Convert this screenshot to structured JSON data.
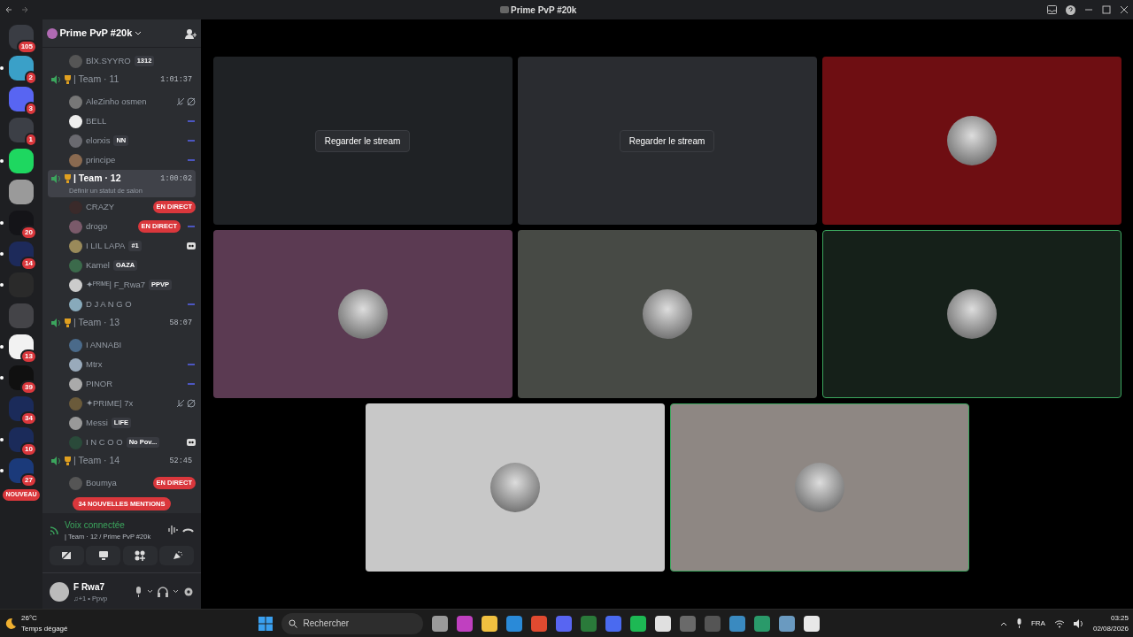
{
  "window": {
    "title": "Prime PvP #20k"
  },
  "servers": [
    {
      "badge": "105",
      "unread": false,
      "color": "#3a3d44"
    },
    {
      "badge": "2",
      "unread": true,
      "color": "#3aa0c8"
    },
    {
      "badge": "3",
      "unread": false,
      "color": "#5865f2"
    },
    {
      "badge": "1",
      "unread": false,
      "color": "#3c3f46"
    },
    {
      "unread": true,
      "color": "#1ed760"
    },
    {
      "unread": false,
      "color": "#9a9a9a"
    },
    {
      "badge": "20",
      "unread": true,
      "color": "#141418"
    },
    {
      "badge": "14",
      "unread": true,
      "color": "#1d2a5a"
    },
    {
      "unread": true,
      "color": "#2a2a2a"
    },
    {
      "unread": false,
      "color": "#444448"
    },
    {
      "badge": "13",
      "unread": true,
      "color": "#f2f2f2"
    },
    {
      "badge": "39",
      "unread": true,
      "color": "#101010"
    },
    {
      "badge": "34",
      "unread": false,
      "color": "#1b2b5a"
    },
    {
      "badge": "10",
      "unread": true,
      "color": "#1b2b5a"
    },
    {
      "badge": "27",
      "unread": true,
      "color": "#1b3a7a"
    }
  ],
  "new_pill": "NOUVEAU",
  "guild": {
    "name": "Prime PvP #20k"
  },
  "channel_list": [
    {
      "kind": "member",
      "name": "BlX.SYYRO",
      "tag": "1312",
      "muted": false,
      "streaming": false,
      "watching": false
    },
    {
      "kind": "channel",
      "name": "| Team · 11",
      "time": "1:01:37",
      "selected": false
    },
    {
      "kind": "member",
      "name": "AleZinho osmen",
      "muted": true,
      "streaming": false,
      "watching": false
    },
    {
      "kind": "member",
      "name": "BELL",
      "muted": false,
      "streaming": true,
      "watching": false
    },
    {
      "kind": "member",
      "name": "elorxis",
      "tag": "NN",
      "muted": false,
      "streaming": true,
      "watching": false
    },
    {
      "kind": "member",
      "name": "principe",
      "muted": false,
      "streaming": true,
      "watching": false
    },
    {
      "kind": "channel",
      "name": "| Team · 12",
      "time": "1:00:02",
      "selected": true,
      "status": "Définir un statut de salon"
    },
    {
      "kind": "member",
      "name": "CRAZY",
      "live": "EN DIRECT",
      "muted": false,
      "streaming": false,
      "watching": false
    },
    {
      "kind": "member",
      "name": "drogo",
      "live": "EN DIRECT",
      "muted": false,
      "streaming": true,
      "watching": false
    },
    {
      "kind": "member",
      "name": "I LIL LAPA",
      "tag": "#1",
      "muted": false,
      "streaming": false,
      "watching": true
    },
    {
      "kind": "member",
      "name": "Kamel",
      "tag": "GAZA",
      "muted": false,
      "streaming": false,
      "watching": false
    },
    {
      "kind": "member",
      "name": "✦ᴾᴿᴵᴹᴱ| F_Rwa7",
      "tag": "PPVP",
      "muted": false,
      "streaming": false,
      "watching": false
    },
    {
      "kind": "member",
      "name": "D J A N G O",
      "muted": false,
      "streaming": true,
      "watching": false
    },
    {
      "kind": "channel",
      "name": "| Team · 13",
      "time": "58:07",
      "selected": false
    },
    {
      "kind": "member",
      "name": "I ANNABI",
      "muted": false,
      "streaming": false,
      "watching": false
    },
    {
      "kind": "member",
      "name": "Mtrx",
      "muted": false,
      "streaming": true,
      "watching": false
    },
    {
      "kind": "member",
      "name": "PINOR",
      "muted": false,
      "streaming": true,
      "watching": false
    },
    {
      "kind": "member",
      "name": "✦PRIME| 7x",
      "muted": true,
      "streaming": false,
      "watching": false
    },
    {
      "kind": "member",
      "name": "Messi",
      "tag": "LIFE",
      "muted": false,
      "streaming": false,
      "watching": false
    },
    {
      "kind": "member",
      "name": "I N C O O",
      "tag": "No Pov...",
      "muted": false,
      "streaming": false,
      "watching": true
    },
    {
      "kind": "channel",
      "name": "| Team · 14",
      "time": "52:45",
      "selected": false
    },
    {
      "kind": "member",
      "name": "Boumya",
      "live": "EN DIRECT",
      "muted": false,
      "streaming": false,
      "watching": false
    }
  ],
  "mentions_pill": "34 NOUVELLES MENTIONS",
  "voice": {
    "status": "Voix connectée",
    "channel": "| Team · 12 / Prime PvP #20k"
  },
  "user": {
    "name": "F Rwa7",
    "activity": "♫+1 • Ppvp"
  },
  "tiles": [
    {
      "kind": "stream",
      "button": "Regarder le stream",
      "color": "#1f2225",
      "speaking": false
    },
    {
      "kind": "stream",
      "button": "Regarder le stream",
      "color": "#2a2c30",
      "speaking": false
    },
    {
      "kind": "avatar",
      "color": "#6e0e12",
      "speaking": false
    },
    {
      "kind": "avatar",
      "color": "#5b3a52",
      "speaking": false
    },
    {
      "kind": "avatar",
      "color": "#474a45",
      "speaking": false
    },
    {
      "kind": "avatar",
      "color": "#152019",
      "speaking": true
    },
    {
      "kind": "avatar",
      "color": "#c8c8c8",
      "speaking": false
    },
    {
      "kind": "avatar",
      "color": "#8e8783",
      "speaking": true
    }
  ],
  "weather": {
    "temperature": "26°C",
    "condition": "Temps dégagé"
  },
  "taskbar": {
    "search_placeholder": "Rechercher",
    "language": "FRA",
    "time": "03:25",
    "date": "02/08/2026"
  }
}
